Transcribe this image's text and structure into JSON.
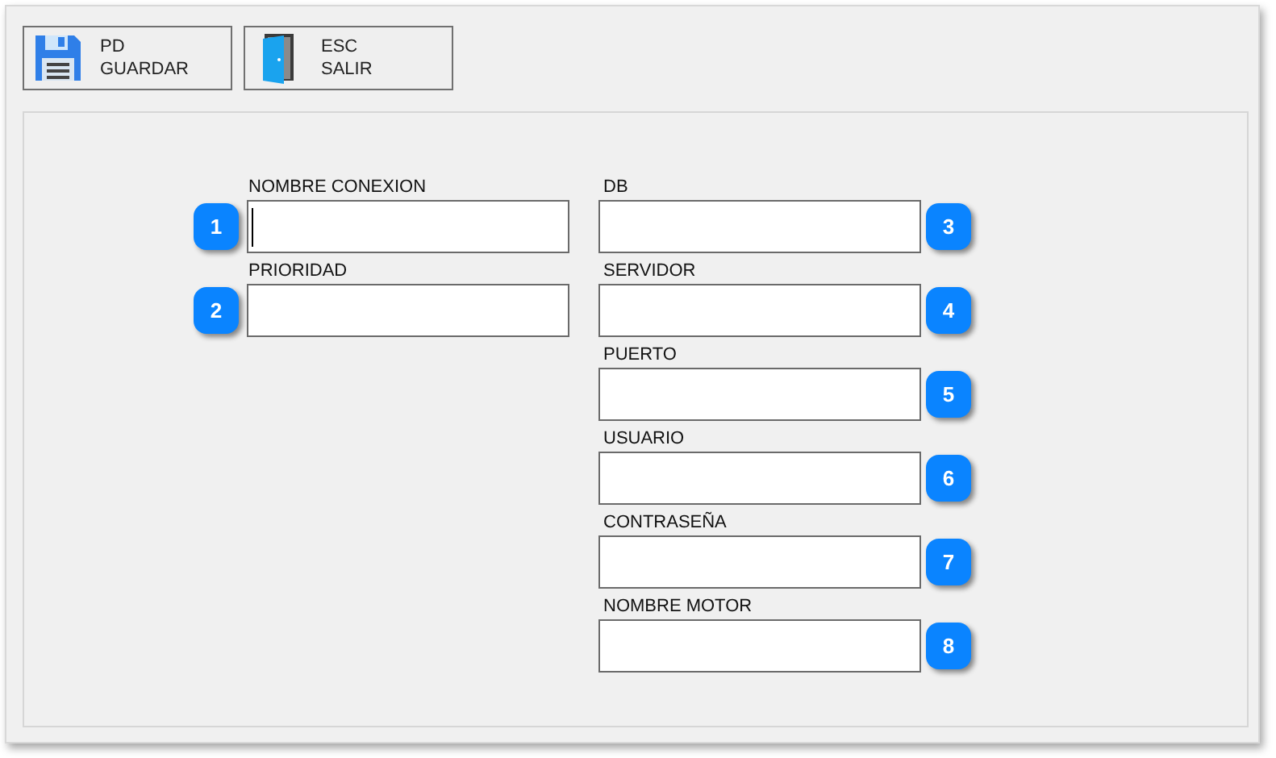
{
  "toolbar": [
    {
      "kind": "save",
      "key": "PD",
      "label": "GUARDAR"
    },
    {
      "kind": "exit",
      "key": "ESC",
      "label": "SALIR"
    }
  ],
  "left_fields": [
    {
      "label": "NOMBRE CONEXION",
      "badge": "1",
      "focused": true
    },
    {
      "label": "PRIORIDAD",
      "badge": "2",
      "focused": false
    }
  ],
  "right_fields": [
    {
      "label": "DB",
      "badge": "3",
      "focused": false
    },
    {
      "label": "SERVIDOR",
      "badge": "4",
      "focused": false
    },
    {
      "label": "PUERTO",
      "badge": "5",
      "focused": false
    },
    {
      "label": "USUARIO",
      "badge": "6",
      "focused": false
    },
    {
      "label": "CONTRASEÑA",
      "badge": "7",
      "focused": false
    },
    {
      "label": "NOMBRE MOTOR",
      "badge": "8",
      "focused": false
    }
  ]
}
